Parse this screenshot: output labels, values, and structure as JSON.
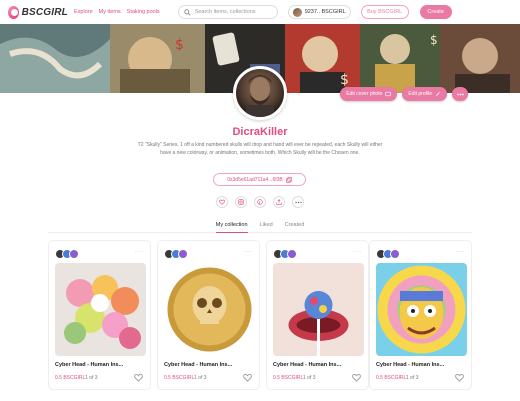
{
  "header": {
    "logo_text": "BSCGIRL",
    "nav": [
      "Explore",
      "My items",
      "Staking pools"
    ],
    "search_placeholder": "Search items, collections",
    "wallet_balance": "9237.. BSCGIRL",
    "buy_label": "Buy BSCGIRL",
    "create_label": "Create"
  },
  "cover": {
    "edit_cover_label": "Edit cover photo",
    "edit_profile_label": "Edit profile"
  },
  "profile": {
    "name": "DicraKiller",
    "bio": "T2 \"Skully\" Series. 1 off a kind numbered skulls will drop and hand will ever be repeated, each Skully will either have a new colorway, or animation, sometimes both. Which Skully will be the Chosen one.",
    "address": "0x3d5e61ad711a4...6f3B",
    "socials": [
      "heart-icon",
      "instagram-icon",
      "pinterest-icon",
      "share-icon",
      "more-icon"
    ]
  },
  "tabs": [
    {
      "label": "My collection",
      "active": true
    },
    {
      "label": "Liked",
      "active": false
    },
    {
      "label": "Created",
      "active": false
    }
  ],
  "cards": [
    {
      "title": "Cyber Head - Human Ins...",
      "price": "0.5 BSCGIRL",
      "count": "1 of 3",
      "image": "flower-bouquet"
    },
    {
      "title": "Cyber Head - Human Ins...",
      "price": "0.5 BSCGIRL",
      "count": "1 of 3",
      "image": "gold-skull-coin"
    },
    {
      "title": "Cyber Head - Human Ins...",
      "price": "0.5 BSCGIRL",
      "count": "1 of 3",
      "image": "lips-lollipop"
    },
    {
      "title": "Cyber Head - Human Ins...",
      "price": "0.5 BSCGIRL",
      "count": "1 of 3",
      "image": "rainbow-cartoon"
    }
  ],
  "colors": {
    "accent": "#e04c82",
    "accent_soft": "#e87aa3"
  }
}
